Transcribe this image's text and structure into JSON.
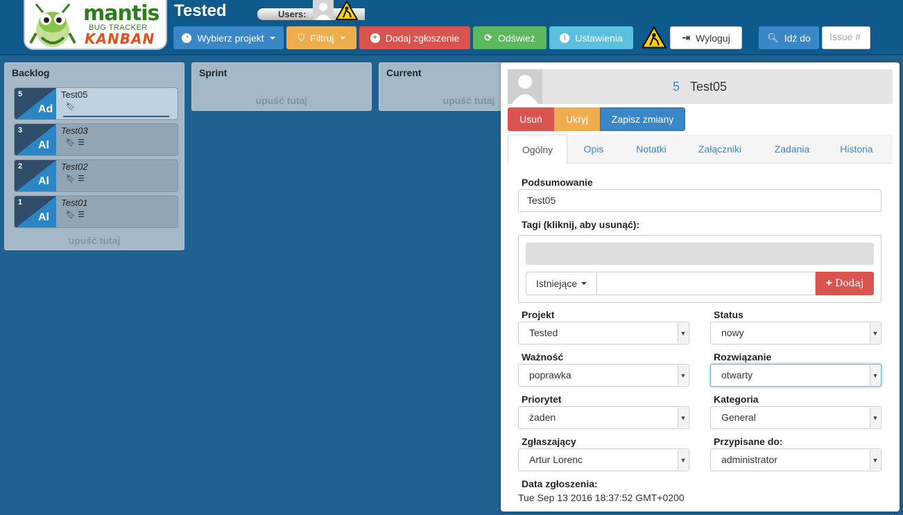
{
  "header": {
    "logo_main": "mantis",
    "logo_sub": "BUG TRACKER",
    "logo_kanban": "KANBAN",
    "project_title": "Tested",
    "users_label": "Users:"
  },
  "toolbar": {
    "choose_project": "Wybierz projekt",
    "filter": "Filtruj",
    "add_issue": "Dodaj zgłoszenie",
    "refresh": "Odśwież",
    "settings": "Ustawienia",
    "logout": "Wyloguj",
    "go_to": "Idź do",
    "issue_placeholder": "Issue #"
  },
  "colors": {
    "background": "#1f6190",
    "header": "#0e5a8c",
    "card_triangle": "#2f4d6b",
    "card_triangle_accent": "#2a86c4"
  },
  "columns": [
    {
      "title": "Backlog",
      "drop_label": "upuść tutaj"
    },
    {
      "title": "Sprint",
      "drop_label": "upuść tutaj"
    },
    {
      "title": "Current",
      "drop_label": "upuść tutaj"
    }
  ],
  "cards": [
    {
      "id": "5",
      "abbr": "Ad",
      "title": "Test05"
    },
    {
      "id": "3",
      "abbr": "Al",
      "title": "Test03"
    },
    {
      "id": "2",
      "abbr": "Al",
      "title": "Test02"
    },
    {
      "id": "1",
      "abbr": "Al",
      "title": "Test01"
    }
  ],
  "detail": {
    "issue_id": "5",
    "issue_title": "Test05",
    "actions": {
      "delete": "Usuń",
      "hide": "Ukryj",
      "save": "Zapisz zmiany"
    },
    "tabs": [
      "Ogólny",
      "Opis",
      "Notatki",
      "Załączniki",
      "Zadania",
      "Historia"
    ],
    "summary_label": "Podsumowanie",
    "summary_value": "Test05",
    "tags_label": "Tagi (kliknij, aby usunąć):",
    "tags_existing": "Istniejące",
    "tags_add": "Dodaj",
    "fields": {
      "project": {
        "label": "Projekt",
        "value": "Tested"
      },
      "status": {
        "label": "Status",
        "value": "nowy"
      },
      "severity": {
        "label": "Ważność",
        "value": "poprawka"
      },
      "resolution": {
        "label": "Rozwiązanie",
        "value": "otwarty"
      },
      "priority": {
        "label": "Priorytet",
        "value": "żaden"
      },
      "category": {
        "label": "Kategoria",
        "value": "General"
      },
      "reporter": {
        "label": "Zgłaszający",
        "value": "Artur Lorenc"
      },
      "assigned": {
        "label": "Przypisane do:",
        "value": "administrator"
      }
    },
    "date_label": "Data zgłoszenia:",
    "date_value": "Tue Sep 13 2016 18:37:52 GMT+0200"
  }
}
